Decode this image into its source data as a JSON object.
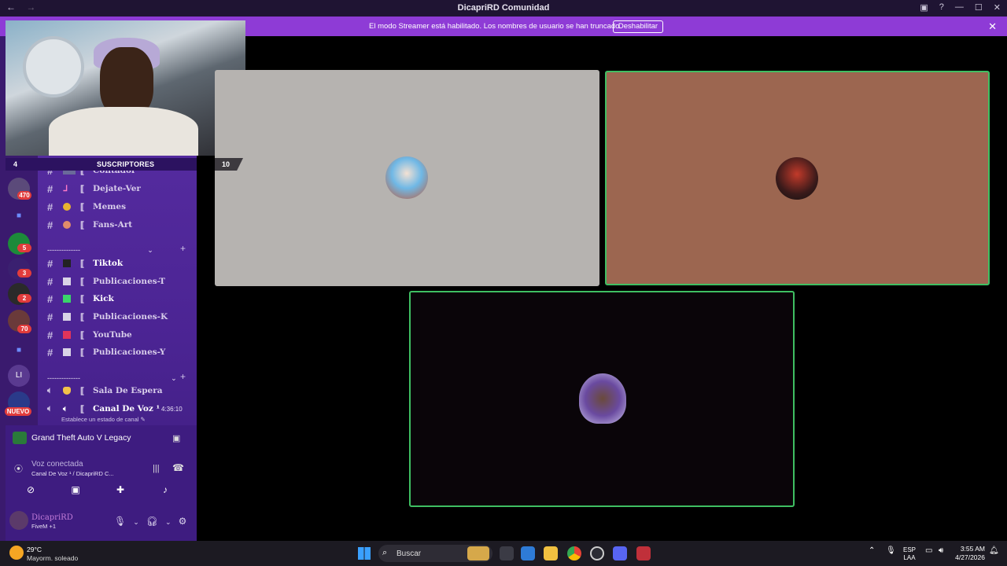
{
  "window": {
    "title": "DicapriRD Comunidad",
    "nav_back": "←",
    "nav_forward": "→"
  },
  "banner": {
    "text": "El modo Streamer está habilitado. Los nombres de usuario se han truncado.",
    "button": "Deshabilitar",
    "close": "✕"
  },
  "servers": {
    "badges": [
      "470",
      "5",
      "3",
      "2",
      "70"
    ],
    "letters": "LI",
    "new_label": "NUEVO"
  },
  "webcam": {
    "subscriber_count": "4",
    "subscriber_label": "SUSCRIPTORES"
  },
  "channels": {
    "partial": "Contador",
    "items_top": [
      {
        "name": "Dejate-Ver"
      },
      {
        "name": "Memes"
      },
      {
        "name": "Fans-Art"
      }
    ],
    "category1": "--------------ᅠᅠᅠᅠᅠᅠᅠᅠᅠᅠ",
    "items_mid": [
      {
        "name": "Tiktok"
      },
      {
        "name": "Publicaciones-T"
      },
      {
        "name": "Kick"
      },
      {
        "name": "Publicaciones-K"
      },
      {
        "name": "YouTube"
      },
      {
        "name": "Publicaciones-Y"
      }
    ],
    "category2": "--------------ᅠᅠᅠᅠᅠᅠᅠᅠ ᅠᅠ ᅠᅠᅠ",
    "voice": [
      {
        "name": "Sala De Espera"
      },
      {
        "name": "Canal De Voz ¹"
      }
    ],
    "voice_time": "4:36:10",
    "voice_status": "Establece un estado de canal"
  },
  "activity": {
    "game": "Grand Theft Auto V Legacy"
  },
  "voice_panel": {
    "title": "Voz conectada",
    "subtitle": "Canal De Voz ¹ / DicapriRD C..."
  },
  "user": {
    "name": "DicapriRD",
    "status": "FiveM +1"
  },
  "stage": {
    "participant_count": "10"
  },
  "taskbar": {
    "weather_temp": "29°C",
    "weather_desc": "Mayorm. soleado",
    "search": "Buscar",
    "lang1": "ESP",
    "lang2": "LAA",
    "time": "3:55 AM",
    "date": "4/27/2026"
  },
  "colors": {
    "banner": "#8e3bd6",
    "sidebar": "#5a2fa6",
    "speaking_border": "#3fbf62"
  }
}
